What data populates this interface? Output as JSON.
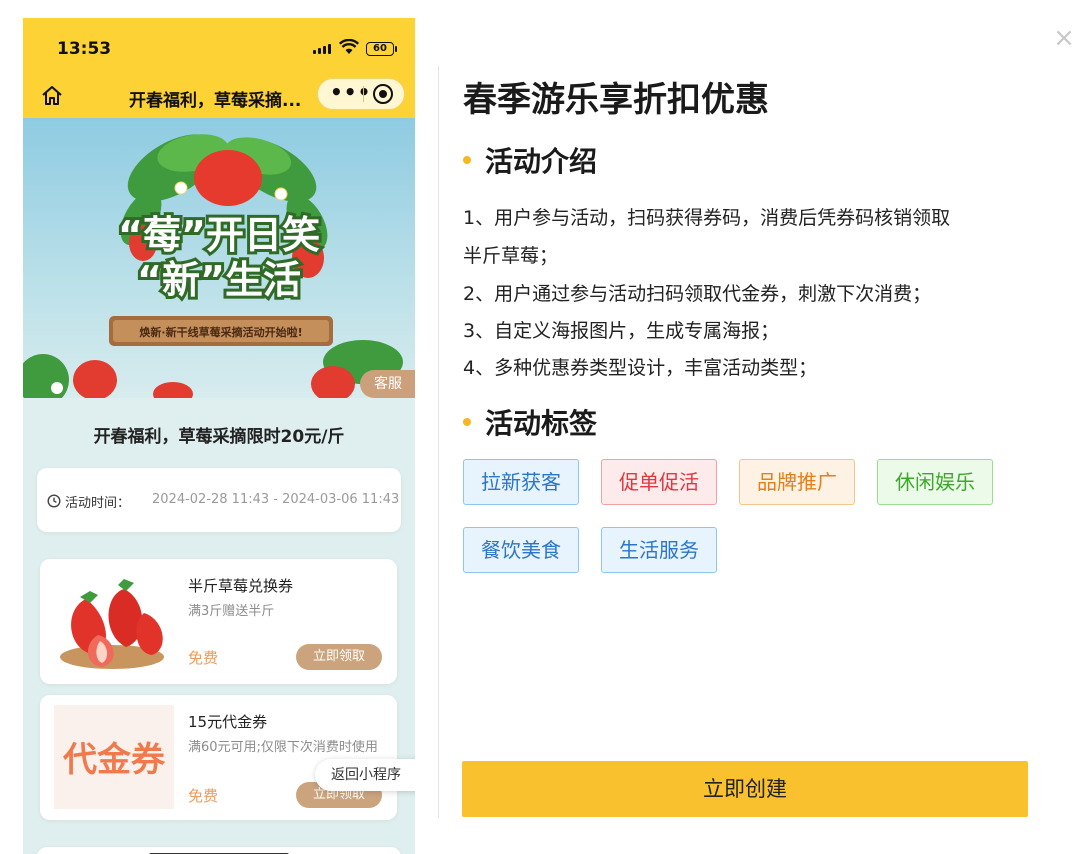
{
  "dialog": {
    "close_icon": "close-icon"
  },
  "phone": {
    "status_bar": {
      "time": "13:53",
      "battery": "60"
    },
    "nav": {
      "title": "开春福利，草莓采摘...",
      "more": "•••",
      "home_icon": "home-icon"
    },
    "banner": {
      "line1": "“莓”开日笑",
      "line2": "“新”生活",
      "plaque": "焕新·新干线草莓采摘活动开始啦!"
    },
    "customer_service": "客服",
    "headline": "开春福利，草莓采摘限时20元/斤",
    "activity_time": {
      "label": "活动时间：",
      "value": "2024-02-28 11:43 - 2024-03-06 11:43"
    },
    "coupons": [
      {
        "title": "半斤草莓兑换券",
        "desc": "满3斤赠送半斤",
        "price": "免费",
        "button": "立即领取"
      },
      {
        "title": "15元代金券",
        "desc": "满60元可用;仅限下次消费时使用",
        "price": "免费",
        "button": "立即领取",
        "image_text": "代金券"
      }
    ],
    "back_to_miniprogram": "返回小程序"
  },
  "panel": {
    "title": "春季游乐享折扣优惠",
    "intro_heading": "活动介绍",
    "intro_lines": [
      "1、用户参与活动，扫码获得券码，消费后凭券码核销领取",
      "半斤草莓；",
      "2、用户通过参与活动扫码领取代金券，刺激下次消费；",
      "3、自定义海报图片，生成专属海报；",
      "4、多种优惠券类型设计，丰富活动类型；"
    ],
    "tags_heading": "活动标签",
    "tags": [
      "拉新获客",
      "促单促活",
      "品牌推广",
      "休闲娱乐",
      "餐饮美食",
      "生活服务"
    ],
    "colors": {
      "accent": "#f9c12e",
      "yellow_bar": "#fdd234",
      "tag_blue": "#2b76c9",
      "tag_red": "#e2373f",
      "tag_orange": "#e47f1a",
      "tag_green": "#3ca82a"
    },
    "create_button": "立即创建"
  }
}
